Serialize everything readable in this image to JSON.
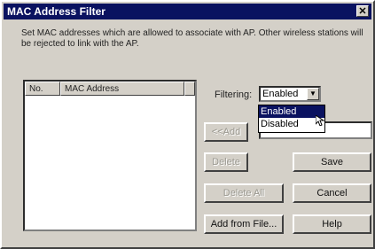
{
  "window": {
    "title": "MAC Address Filter",
    "close_glyph": "✕"
  },
  "description": "Set MAC addresses which are allowed to associate with AP. Other wireless stations will be rejected to link with the AP.",
  "table": {
    "columns": [
      "No.",
      "MAC Address"
    ]
  },
  "filtering": {
    "label": "Filtering:",
    "value": "Enabled",
    "options": [
      "Enabled",
      "Disabled"
    ]
  },
  "buttons": {
    "add": "<<Add",
    "delete": "Delete",
    "delete_all": "Delete All",
    "add_from_file": "Add from File...",
    "save": "Save",
    "cancel": "Cancel",
    "help": "Help"
  }
}
